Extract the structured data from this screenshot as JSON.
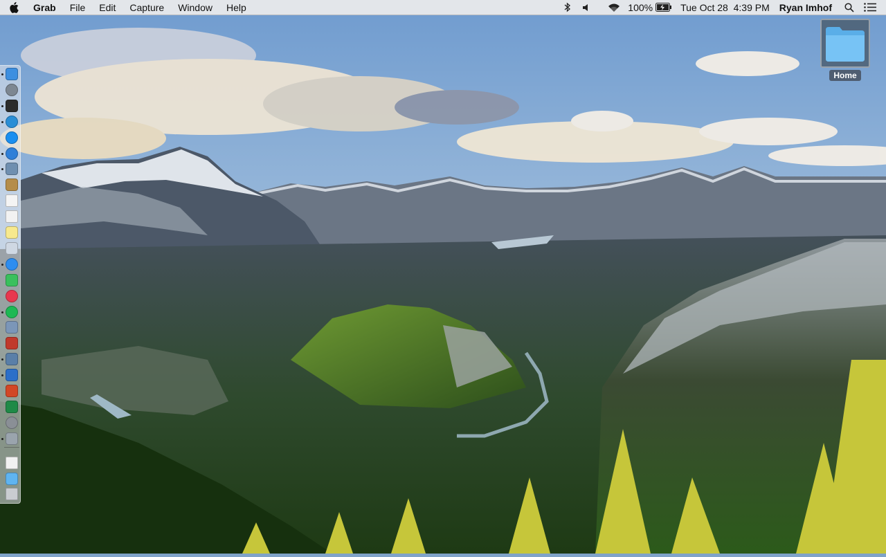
{
  "menubar": {
    "app_name": "Grab",
    "menus": [
      "File",
      "Edit",
      "Capture",
      "Window",
      "Help"
    ],
    "status": {
      "bluetooth_icon": "bluetooth-icon",
      "volume_icon": "volume-icon",
      "wifi_icon": "wifi-icon",
      "battery_percent": "100%",
      "battery_icon": "battery-charging-icon",
      "datetime": "Tue Oct 28  4:39 PM",
      "user": "Ryan Imhof",
      "search_icon": "spotlight-search-icon",
      "notifications_icon": "notification-center-icon"
    }
  },
  "desktop": {
    "items": [
      {
        "label": "Home",
        "icon": "folder-icon"
      }
    ]
  },
  "dock": {
    "items": [
      {
        "name": "finder-icon",
        "color": "#3d8fe0",
        "running": true
      },
      {
        "name": "launchpad-icon",
        "color": "#7d8792",
        "running": false
      },
      {
        "name": "activity-monitor-icon",
        "color": "#2c2c2c",
        "running": true
      },
      {
        "name": "browser-icon",
        "color": "#2a8ed6",
        "running": true
      },
      {
        "name": "app-store-icon",
        "color": "#1b8ff0",
        "running": false
      },
      {
        "name": "safari-icon",
        "color": "#2f7fd8",
        "running": true
      },
      {
        "name": "preview-icon",
        "color": "#6f8fb0",
        "running": true
      },
      {
        "name": "notebook-icon",
        "color": "#b58d4a",
        "running": false
      },
      {
        "name": "calendar-icon",
        "color": "#f4f4f4",
        "running": false
      },
      {
        "name": "textedit-icon",
        "color": "#f2f2f2",
        "running": false
      },
      {
        "name": "notes-icon",
        "color": "#f7e98e",
        "running": false
      },
      {
        "name": "script-editor-icon",
        "color": "#cfd8e3",
        "running": false
      },
      {
        "name": "messages-icon",
        "color": "#2d8df0",
        "running": true
      },
      {
        "name": "facetime-icon",
        "color": "#3ac05d",
        "running": false
      },
      {
        "name": "itunes-icon",
        "color": "#e8384f",
        "running": false
      },
      {
        "name": "spotify-icon",
        "color": "#1db954",
        "running": true
      },
      {
        "name": "image-capture-icon",
        "color": "#7b96b8",
        "running": false
      },
      {
        "name": "photo-booth-icon",
        "color": "#c0392b",
        "running": false
      },
      {
        "name": "photos-icon",
        "color": "#5a7fa8",
        "running": true
      },
      {
        "name": "word-icon",
        "color": "#2b6fc9",
        "running": true
      },
      {
        "name": "powerpoint-icon",
        "color": "#d24726",
        "running": false
      },
      {
        "name": "excel-icon",
        "color": "#1f8a47",
        "running": false
      },
      {
        "name": "system-preferences-icon",
        "color": "#8a8f96",
        "running": false
      },
      {
        "name": "grab-icon",
        "color": "#9aa4ad",
        "running": true
      },
      {
        "name": "documents-stack-icon",
        "color": "#f1f1f1",
        "running": false
      },
      {
        "name": "downloads-folder-icon",
        "color": "#5fb4f0",
        "running": false
      },
      {
        "name": "trash-icon",
        "color": "#c9ccd1",
        "running": false
      }
    ]
  }
}
